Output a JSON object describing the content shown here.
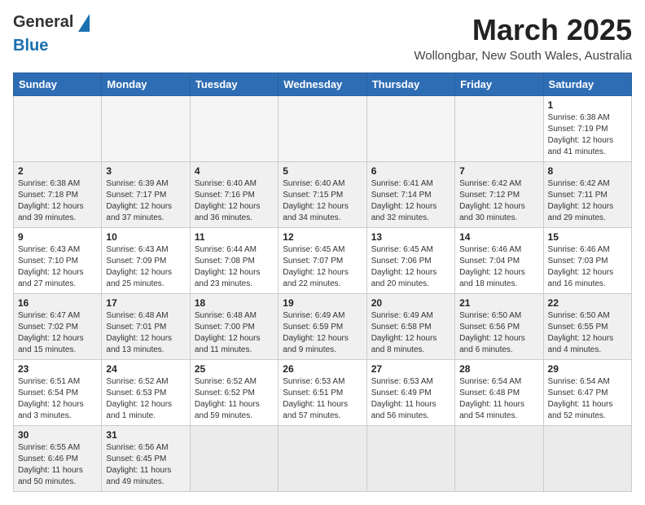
{
  "header": {
    "logo_general": "General",
    "logo_blue": "Blue",
    "month_title": "March 2025",
    "location": "Wollongbar, New South Wales, Australia"
  },
  "weekdays": [
    "Sunday",
    "Monday",
    "Tuesday",
    "Wednesday",
    "Thursday",
    "Friday",
    "Saturday"
  ],
  "weeks": [
    [
      {
        "day": "",
        "info": ""
      },
      {
        "day": "",
        "info": ""
      },
      {
        "day": "",
        "info": ""
      },
      {
        "day": "",
        "info": ""
      },
      {
        "day": "",
        "info": ""
      },
      {
        "day": "",
        "info": ""
      },
      {
        "day": "1",
        "info": "Sunrise: 6:38 AM\nSunset: 7:19 PM\nDaylight: 12 hours and 41 minutes."
      }
    ],
    [
      {
        "day": "2",
        "info": "Sunrise: 6:38 AM\nSunset: 7:18 PM\nDaylight: 12 hours and 39 minutes."
      },
      {
        "day": "3",
        "info": "Sunrise: 6:39 AM\nSunset: 7:17 PM\nDaylight: 12 hours and 37 minutes."
      },
      {
        "day": "4",
        "info": "Sunrise: 6:40 AM\nSunset: 7:16 PM\nDaylight: 12 hours and 36 minutes."
      },
      {
        "day": "5",
        "info": "Sunrise: 6:40 AM\nSunset: 7:15 PM\nDaylight: 12 hours and 34 minutes."
      },
      {
        "day": "6",
        "info": "Sunrise: 6:41 AM\nSunset: 7:14 PM\nDaylight: 12 hours and 32 minutes."
      },
      {
        "day": "7",
        "info": "Sunrise: 6:42 AM\nSunset: 7:12 PM\nDaylight: 12 hours and 30 minutes."
      },
      {
        "day": "8",
        "info": "Sunrise: 6:42 AM\nSunset: 7:11 PM\nDaylight: 12 hours and 29 minutes."
      }
    ],
    [
      {
        "day": "9",
        "info": "Sunrise: 6:43 AM\nSunset: 7:10 PM\nDaylight: 12 hours and 27 minutes."
      },
      {
        "day": "10",
        "info": "Sunrise: 6:43 AM\nSunset: 7:09 PM\nDaylight: 12 hours and 25 minutes."
      },
      {
        "day": "11",
        "info": "Sunrise: 6:44 AM\nSunset: 7:08 PM\nDaylight: 12 hours and 23 minutes."
      },
      {
        "day": "12",
        "info": "Sunrise: 6:45 AM\nSunset: 7:07 PM\nDaylight: 12 hours and 22 minutes."
      },
      {
        "day": "13",
        "info": "Sunrise: 6:45 AM\nSunset: 7:06 PM\nDaylight: 12 hours and 20 minutes."
      },
      {
        "day": "14",
        "info": "Sunrise: 6:46 AM\nSunset: 7:04 PM\nDaylight: 12 hours and 18 minutes."
      },
      {
        "day": "15",
        "info": "Sunrise: 6:46 AM\nSunset: 7:03 PM\nDaylight: 12 hours and 16 minutes."
      }
    ],
    [
      {
        "day": "16",
        "info": "Sunrise: 6:47 AM\nSunset: 7:02 PM\nDaylight: 12 hours and 15 minutes."
      },
      {
        "day": "17",
        "info": "Sunrise: 6:48 AM\nSunset: 7:01 PM\nDaylight: 12 hours and 13 minutes."
      },
      {
        "day": "18",
        "info": "Sunrise: 6:48 AM\nSunset: 7:00 PM\nDaylight: 12 hours and 11 minutes."
      },
      {
        "day": "19",
        "info": "Sunrise: 6:49 AM\nSunset: 6:59 PM\nDaylight: 12 hours and 9 minutes."
      },
      {
        "day": "20",
        "info": "Sunrise: 6:49 AM\nSunset: 6:58 PM\nDaylight: 12 hours and 8 minutes."
      },
      {
        "day": "21",
        "info": "Sunrise: 6:50 AM\nSunset: 6:56 PM\nDaylight: 12 hours and 6 minutes."
      },
      {
        "day": "22",
        "info": "Sunrise: 6:50 AM\nSunset: 6:55 PM\nDaylight: 12 hours and 4 minutes."
      }
    ],
    [
      {
        "day": "23",
        "info": "Sunrise: 6:51 AM\nSunset: 6:54 PM\nDaylight: 12 hours and 3 minutes."
      },
      {
        "day": "24",
        "info": "Sunrise: 6:52 AM\nSunset: 6:53 PM\nDaylight: 12 hours and 1 minute."
      },
      {
        "day": "25",
        "info": "Sunrise: 6:52 AM\nSunset: 6:52 PM\nDaylight: 11 hours and 59 minutes."
      },
      {
        "day": "26",
        "info": "Sunrise: 6:53 AM\nSunset: 6:51 PM\nDaylight: 11 hours and 57 minutes."
      },
      {
        "day": "27",
        "info": "Sunrise: 6:53 AM\nSunset: 6:49 PM\nDaylight: 11 hours and 56 minutes."
      },
      {
        "day": "28",
        "info": "Sunrise: 6:54 AM\nSunset: 6:48 PM\nDaylight: 11 hours and 54 minutes."
      },
      {
        "day": "29",
        "info": "Sunrise: 6:54 AM\nSunset: 6:47 PM\nDaylight: 11 hours and 52 minutes."
      }
    ],
    [
      {
        "day": "30",
        "info": "Sunrise: 6:55 AM\nSunset: 6:46 PM\nDaylight: 11 hours and 50 minutes."
      },
      {
        "day": "31",
        "info": "Sunrise: 6:56 AM\nSunset: 6:45 PM\nDaylight: 11 hours and 49 minutes."
      },
      {
        "day": "",
        "info": ""
      },
      {
        "day": "",
        "info": ""
      },
      {
        "day": "",
        "info": ""
      },
      {
        "day": "",
        "info": ""
      },
      {
        "day": "",
        "info": ""
      }
    ]
  ]
}
